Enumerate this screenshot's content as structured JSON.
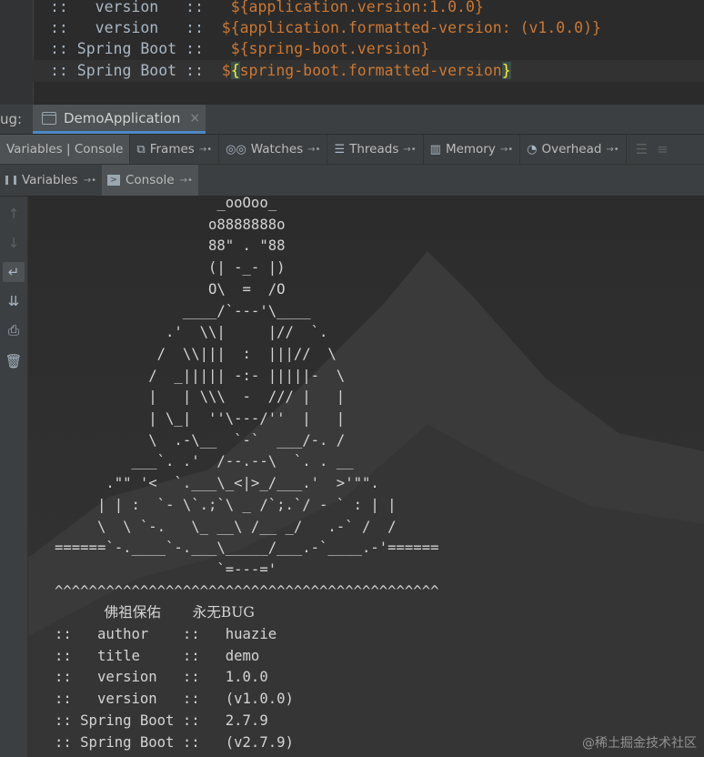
{
  "editor": {
    "lines": [
      {
        "prefix": "::   version   ::   ",
        "expr": "${application.version:1.0.0}"
      },
      {
        "prefix": "::   version   ::  ",
        "expr": "${application.formatted-version: (v1.0.0)}"
      },
      {
        "prefix": ":: Spring Boot ::   ",
        "expr": "${spring-boot.version}"
      },
      {
        "prefix": ":: Spring Boot ::  ",
        "expr_open": "$",
        "expr_brace": "{",
        "expr_rest": "spring-boot.formatted-version",
        "expr_close": "}"
      }
    ]
  },
  "debug_panel": {
    "label": "ug:",
    "run_tab": "DemoApplication",
    "tabs": [
      {
        "label": "Variables | Console",
        "active": true
      },
      {
        "label": "Frames",
        "icon": "frames-icon"
      },
      {
        "label": "Watches",
        "icon": "watches-icon"
      },
      {
        "label": "Threads",
        "icon": "threads-icon"
      },
      {
        "label": "Memory",
        "icon": "memory-icon"
      },
      {
        "label": "Overhead",
        "icon": "overhead-icon"
      }
    ],
    "subtabs": [
      {
        "label": "Variables"
      },
      {
        "label": "Console",
        "active": true
      }
    ]
  },
  "console": {
    "banner_lines": [
      "                   _ooOoo_",
      "                  o8888888o",
      "                  88\" . \"88",
      "                  (| -_- |)",
      "                  O\\  =  /O",
      "               ____/`---'\\____",
      "             .'  \\\\|     |//  `.",
      "            /  \\\\|||  :  |||//  \\",
      "           /  _||||| -:- |||||-  \\",
      "           |   | \\\\\\  -  /// |   |",
      "           | \\_|  ''\\---/''  |   |",
      "           \\  .-\\__  `-`  ___/-. /",
      "         ___`. .'  /--.--\\  `. . __",
      "      .\"\" '<  `.___\\_<|>_/___.'  >'\"\".",
      "     | | :  `- \\`.;`\\ _ /`;.`/ - ` : | |",
      "     \\  \\ `-.   \\_ __\\ /__ _/   .-` /  /",
      "======`-.____`-.___\\_____/___.-`____.-'======",
      "                   `=---='",
      "^^^^^^^^^^^^^^^^^^^^^^^^^^^^^^^^^^^^^^^^^^^^^"
    ],
    "blessing": "           佛祖保佑       永无BUG",
    "info_lines": [
      "::   author    ::   huazie",
      "::   title     ::   demo",
      "::   version   ::   1.0.0",
      "::   version   ::   (v1.0.0)",
      ":: Spring Boot ::   2.7.9",
      ":: Spring Boot ::   (v2.7.9)"
    ]
  },
  "watermark": "@稀土掘金技术社区",
  "colors": {
    "accent": "#4a88c7",
    "placeholder": "#cc7832",
    "background": "#2b2b2b"
  }
}
